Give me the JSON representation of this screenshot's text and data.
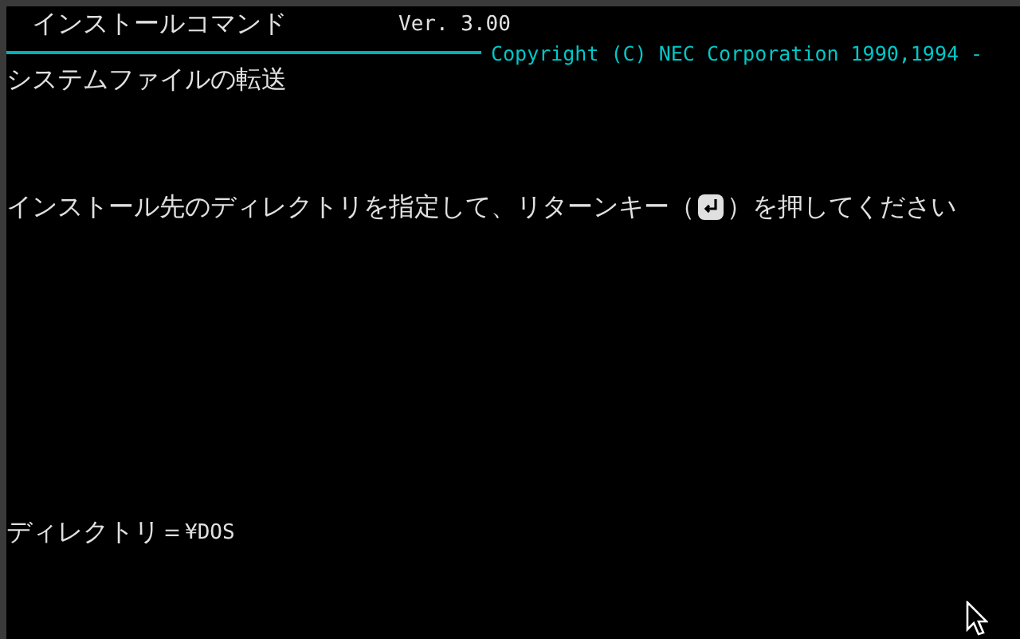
{
  "header": {
    "title": "インストールコマンド",
    "version": "Ver. 3.00",
    "copyright": "Copyright (C) NEC Corporation 1990,1994 -"
  },
  "subtitle": "システムファイルの転送",
  "prompt": {
    "before": "インストール先のディレクトリを指定して、リターンキー（",
    "after": "）を押してください"
  },
  "input": {
    "label": "ディレクトリ＝",
    "value": "¥DOS"
  }
}
